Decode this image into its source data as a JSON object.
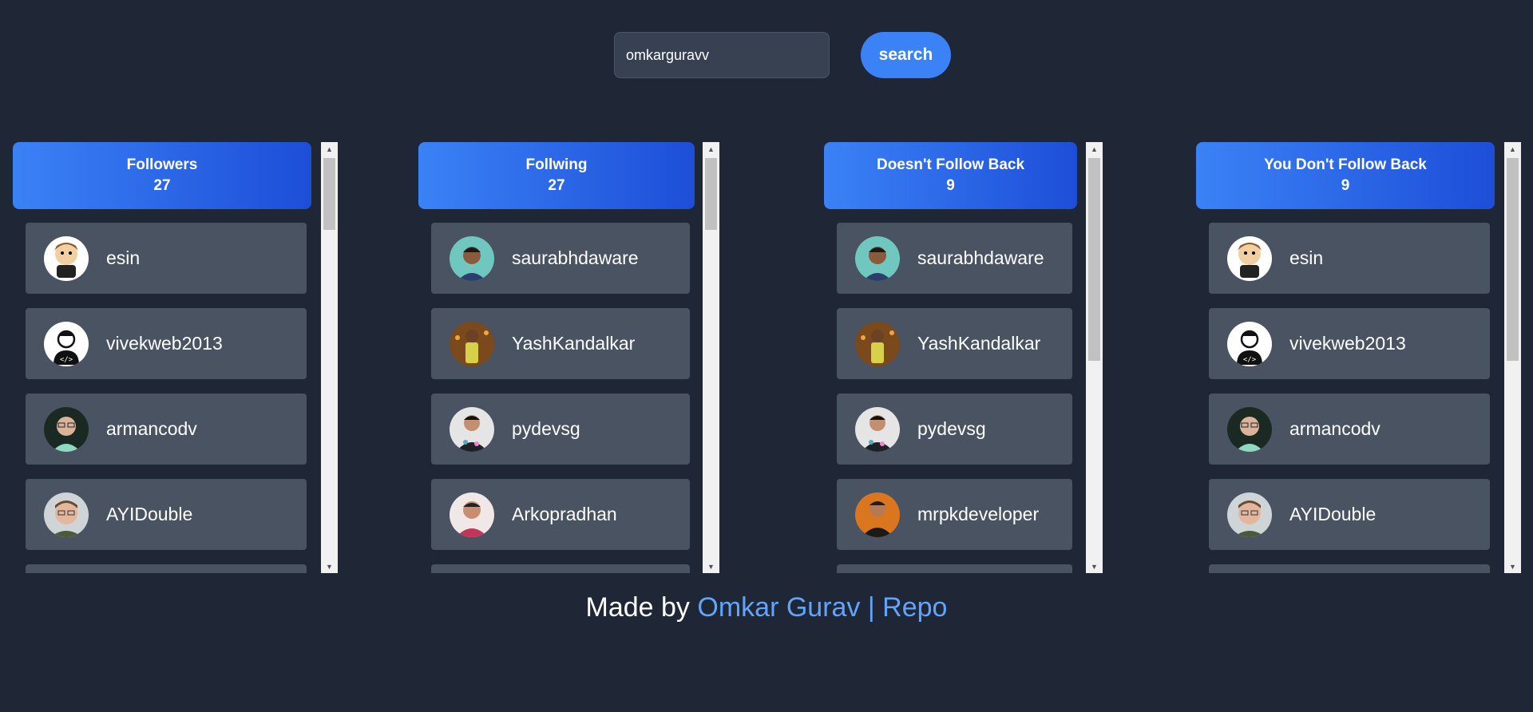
{
  "search": {
    "value": "omkarguravv",
    "button_label": "search"
  },
  "columns": [
    {
      "title": "Followers",
      "count": "27",
      "items": [
        {
          "name": "esin",
          "avatar": "cartoon-avatar"
        },
        {
          "name": "vivekweb2013",
          "avatar": "developer-avatar"
        },
        {
          "name": "armancodv",
          "avatar": "photo-avatar"
        },
        {
          "name": "AYIDouble",
          "avatar": "photo-avatar"
        }
      ]
    },
    {
      "title": "Follwing",
      "count": "27",
      "items": [
        {
          "name": "saurabhdaware",
          "avatar": "photo-avatar"
        },
        {
          "name": "YashKandalkar",
          "avatar": "photo-avatar"
        },
        {
          "name": "pydevsg",
          "avatar": "photo-avatar"
        },
        {
          "name": "Arkopradhan",
          "avatar": "photo-avatar"
        }
      ]
    },
    {
      "title": "Doesn't Follow Back",
      "count": "9",
      "items": [
        {
          "name": "saurabhdaware",
          "avatar": "photo-avatar"
        },
        {
          "name": "YashKandalkar",
          "avatar": "photo-avatar"
        },
        {
          "name": "pydevsg",
          "avatar": "photo-avatar"
        },
        {
          "name": "mrpkdeveloper",
          "avatar": "photo-avatar"
        }
      ]
    },
    {
      "title": "You Don't Follow Back",
      "count": "9",
      "items": [
        {
          "name": "esin",
          "avatar": "cartoon-avatar"
        },
        {
          "name": "vivekweb2013",
          "avatar": "developer-avatar"
        },
        {
          "name": "armancodv",
          "avatar": "photo-avatar"
        },
        {
          "name": "AYIDouble",
          "avatar": "photo-avatar"
        }
      ]
    }
  ],
  "footer": {
    "prefix": "Made by ",
    "author": "Omkar Gurav",
    "separator": " | ",
    "repo": "Repo"
  },
  "colors": {
    "background": "#1f2737",
    "accent": "#3b82f6",
    "card": "#4a5362",
    "link": "#60a5fa"
  }
}
